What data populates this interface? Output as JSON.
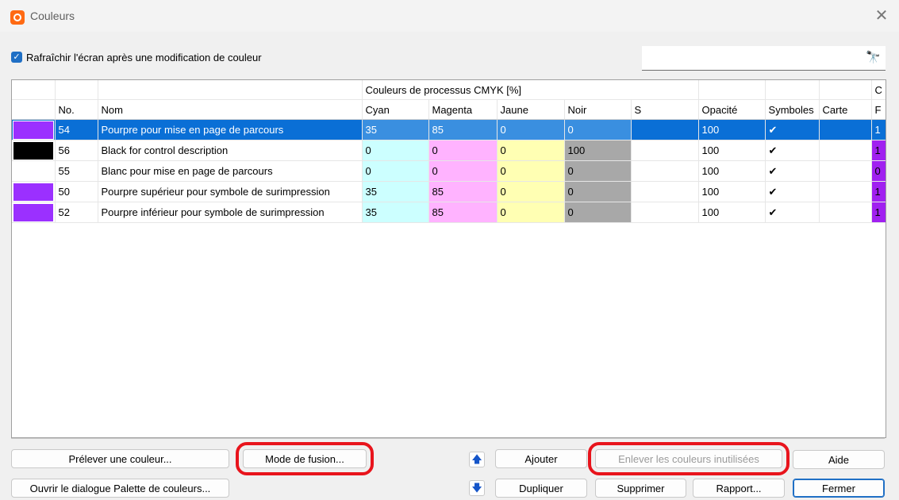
{
  "window": {
    "title": "Couleurs",
    "close": "✕"
  },
  "refresh_checkbox": {
    "label": "Rafraîchir l'écran après une modification de couleur",
    "checked": true
  },
  "search": {
    "value": "",
    "icon": "binoculars-icon"
  },
  "table": {
    "group_header": "Couleurs de processus CMYK [%]",
    "group_header_cut": "C",
    "columns": [
      "No.",
      "Nom",
      "Cyan",
      "Magenta",
      "Jaune",
      "Noir",
      "S",
      "Opacité",
      "Symboles",
      "Carte",
      "F"
    ],
    "rows": [
      {
        "swatch": "#9b30ff",
        "no": "54",
        "nom": "Pourpre pour mise en page de parcours",
        "cyan": "35",
        "magenta": "85",
        "jaune": "0",
        "noir": "0",
        "s": "",
        "opacite": "100",
        "symboles": "✔",
        "carte": "",
        "f": "1",
        "selected": true
      },
      {
        "swatch": "#000000",
        "no": "56",
        "nom": "Black for control description",
        "cyan": "0",
        "magenta": "0",
        "jaune": "0",
        "noir": "100",
        "s": "",
        "opacite": "100",
        "symboles": "✔",
        "carte": "",
        "f": "1",
        "selected": false
      },
      {
        "swatch": "#ffffff",
        "no": "55",
        "nom": "Blanc pour mise en page de parcours",
        "cyan": "0",
        "magenta": "0",
        "jaune": "0",
        "noir": "0",
        "s": "",
        "opacite": "100",
        "symboles": "✔",
        "carte": "",
        "f": "0",
        "selected": false
      },
      {
        "swatch": "#9b30ff",
        "no": "50",
        "nom": "Pourpre supérieur pour symbole de surimpression",
        "cyan": "35",
        "magenta": "85",
        "jaune": "0",
        "noir": "0",
        "s": "",
        "opacite": "100",
        "symboles": "✔",
        "carte": "",
        "f": "1",
        "selected": false
      },
      {
        "swatch": "#9b30ff",
        "no": "52",
        "nom": "Pourpre inférieur pour symbole de surimpression",
        "cyan": "35",
        "magenta": "85",
        "jaune": "0",
        "noir": "0",
        "s": "",
        "opacite": "100",
        "symboles": "✔",
        "carte": "",
        "f": "1",
        "selected": false
      }
    ]
  },
  "buttons": {
    "pick_color": "Prélever une couleur...",
    "open_palette": "Ouvrir le dialogue Palette de couleurs...",
    "blend_mode": "Mode de fusion...",
    "move_up": "🡅",
    "move_down": "🡇",
    "add": "Ajouter",
    "duplicate": "Dupliquer",
    "remove_unused": "Enlever les couleurs inutilisées",
    "delete": "Supprimer",
    "report": "Rapport...",
    "help": "Aide",
    "close": "Fermer"
  },
  "colors": {
    "accent": "#0a6fd6",
    "highlight": "#e8141c",
    "app_icon": "#ff6a13"
  }
}
